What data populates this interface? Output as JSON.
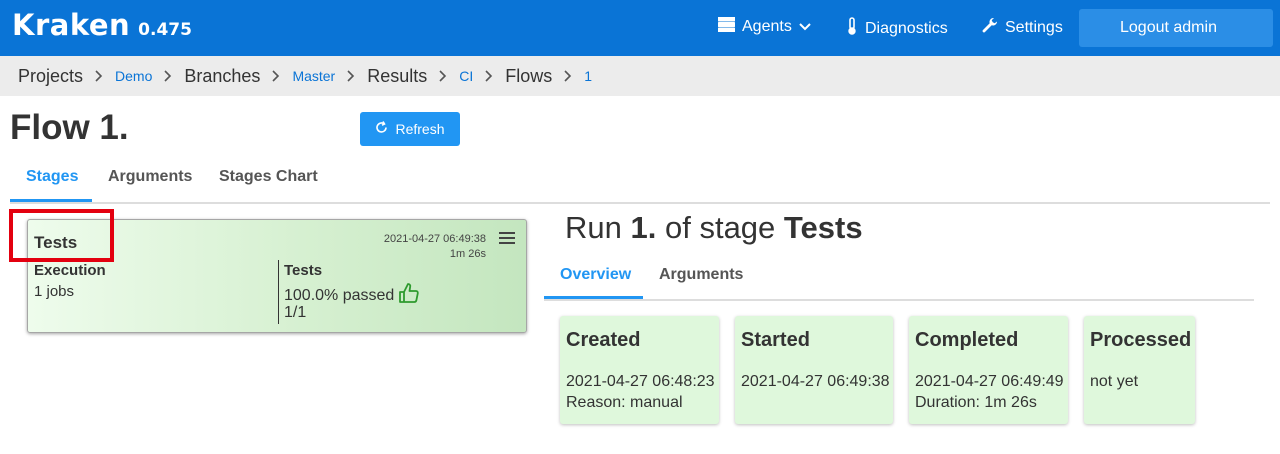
{
  "app": {
    "name": "Kraken",
    "version": "0.475"
  },
  "nav": {
    "agents": "Agents",
    "diagnostics": "Diagnostics",
    "settings": "Settings",
    "logout": "Logout admin"
  },
  "breadcrumb": {
    "projects": "Projects",
    "project": "Demo",
    "branches": "Branches",
    "branch": "Master",
    "results": "Results",
    "results_kind": "CI",
    "flows": "Flows",
    "flow": "1"
  },
  "page": {
    "title": "Flow 1.",
    "refresh": "Refresh"
  },
  "tabs": [
    "Stages",
    "Arguments",
    "Stages Chart"
  ],
  "stage_card": {
    "name": "Tests",
    "timestamp": "2021-04-27 06:49:38",
    "duration": "1m 26s",
    "execution_label": "Execution",
    "execution_value": "1 jobs",
    "tests_label": "Tests",
    "tests_passed": "100.0% passed",
    "tests_ratio": "1/1"
  },
  "run": {
    "prefix": "Run",
    "number": "1.",
    "middle": "of stage",
    "stage": "Tests",
    "tabs": [
      "Overview",
      "Arguments"
    ]
  },
  "cards": {
    "created": {
      "title": "Created",
      "line1": "2021-04-27 06:48:23",
      "line2": "Reason: manual"
    },
    "started": {
      "title": "Started",
      "line1": "2021-04-27 06:49:38"
    },
    "completed": {
      "title": "Completed",
      "line1": "2021-04-27 06:49:49",
      "line2": "Duration: 1m 26s"
    },
    "processed": {
      "title": "Processed",
      "line1": "not yet"
    }
  },
  "colors": {
    "navbar": "#0a74d6",
    "accent": "#2196f3",
    "success": "#2e9a2e",
    "card_bg": "#dff8dc",
    "highlight": "#e3000f"
  },
  "icons": {
    "agents": "server-icon",
    "diagnostics": "thermometer-icon",
    "settings": "wrench-icon",
    "logout": "sign-out-icon",
    "refresh": "refresh-icon",
    "pass": "thumbs-up-icon",
    "menu": "hamburger-icon"
  }
}
